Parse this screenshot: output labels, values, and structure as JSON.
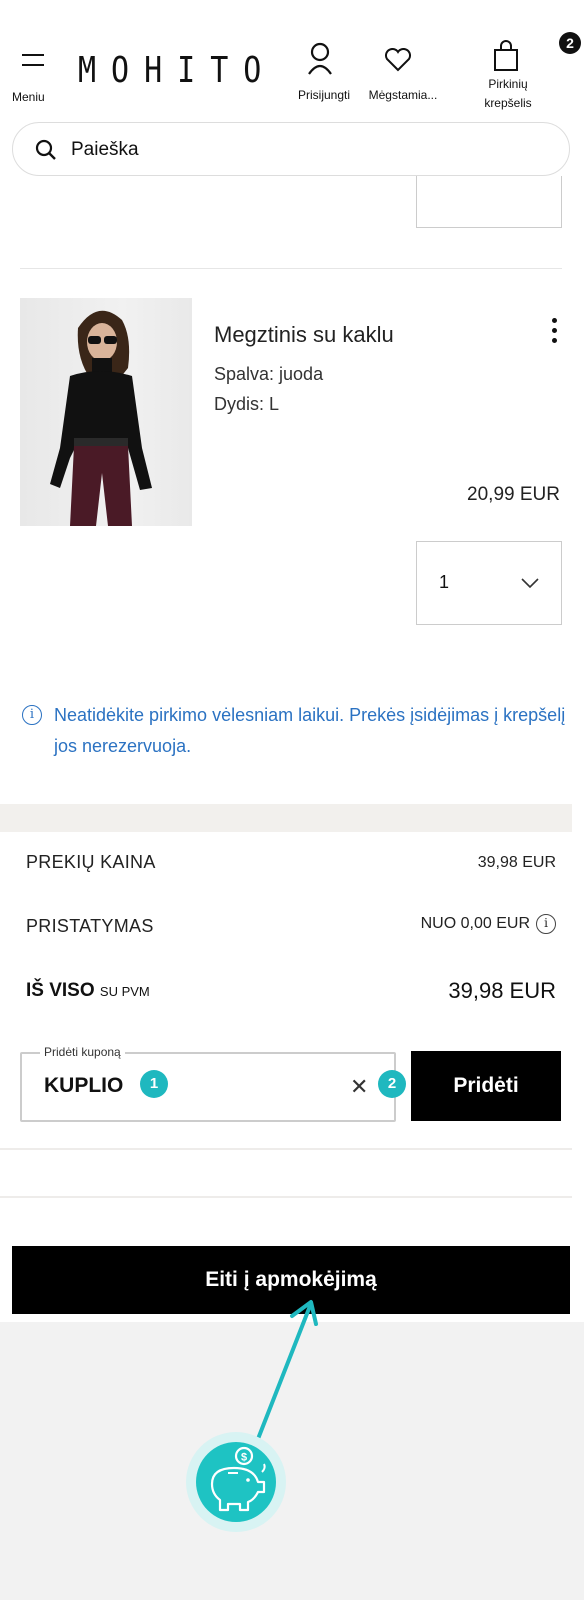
{
  "header": {
    "menu_label": "Meniu",
    "logo": "MOHITO",
    "login_label": "Prisijungti",
    "favorites_label": "Mėgstamia...",
    "cart_label_line1": "Pirkinių",
    "cart_label_line2": "krepšelis",
    "cart_count": "2"
  },
  "search": {
    "placeholder": "Paieška"
  },
  "product": {
    "name": "Megztinis su kaklu",
    "color_line": "Spalva: juoda",
    "size_line": "Dydis: L",
    "price": "20,99 EUR",
    "quantity": "1"
  },
  "notice": {
    "text": "Neatidėkite pirkimo vėlesniam laikui. Prekės įsidėjimas į krepšelį jos nerezervuoja."
  },
  "summary": {
    "items_label": "PREKIŲ KAINA",
    "items_value": "39,98 EUR",
    "shipping_label": "PRISTATYMAS",
    "shipping_value": "NUO 0,00 EUR",
    "total_label": "IŠ VISO",
    "total_sub": "SU PVM",
    "total_value": "39,98 EUR"
  },
  "coupon": {
    "legend": "Pridėti kuponą",
    "value": "KUPLIO",
    "add_label": "Pridėti",
    "marker1": "1",
    "marker2": "2"
  },
  "checkout": {
    "label": "Eiti į apmokėjimą"
  },
  "colors": {
    "accent_teal": "#1fb8bf",
    "notice_blue": "#2b72c2",
    "button_black": "#000000"
  },
  "icons": [
    "menu-icon",
    "user-icon",
    "heart-icon",
    "shopping-bag-icon",
    "search-icon",
    "more-vertical-icon",
    "chevron-down-icon",
    "info-icon",
    "close-icon",
    "piggy-bank-icon"
  ]
}
